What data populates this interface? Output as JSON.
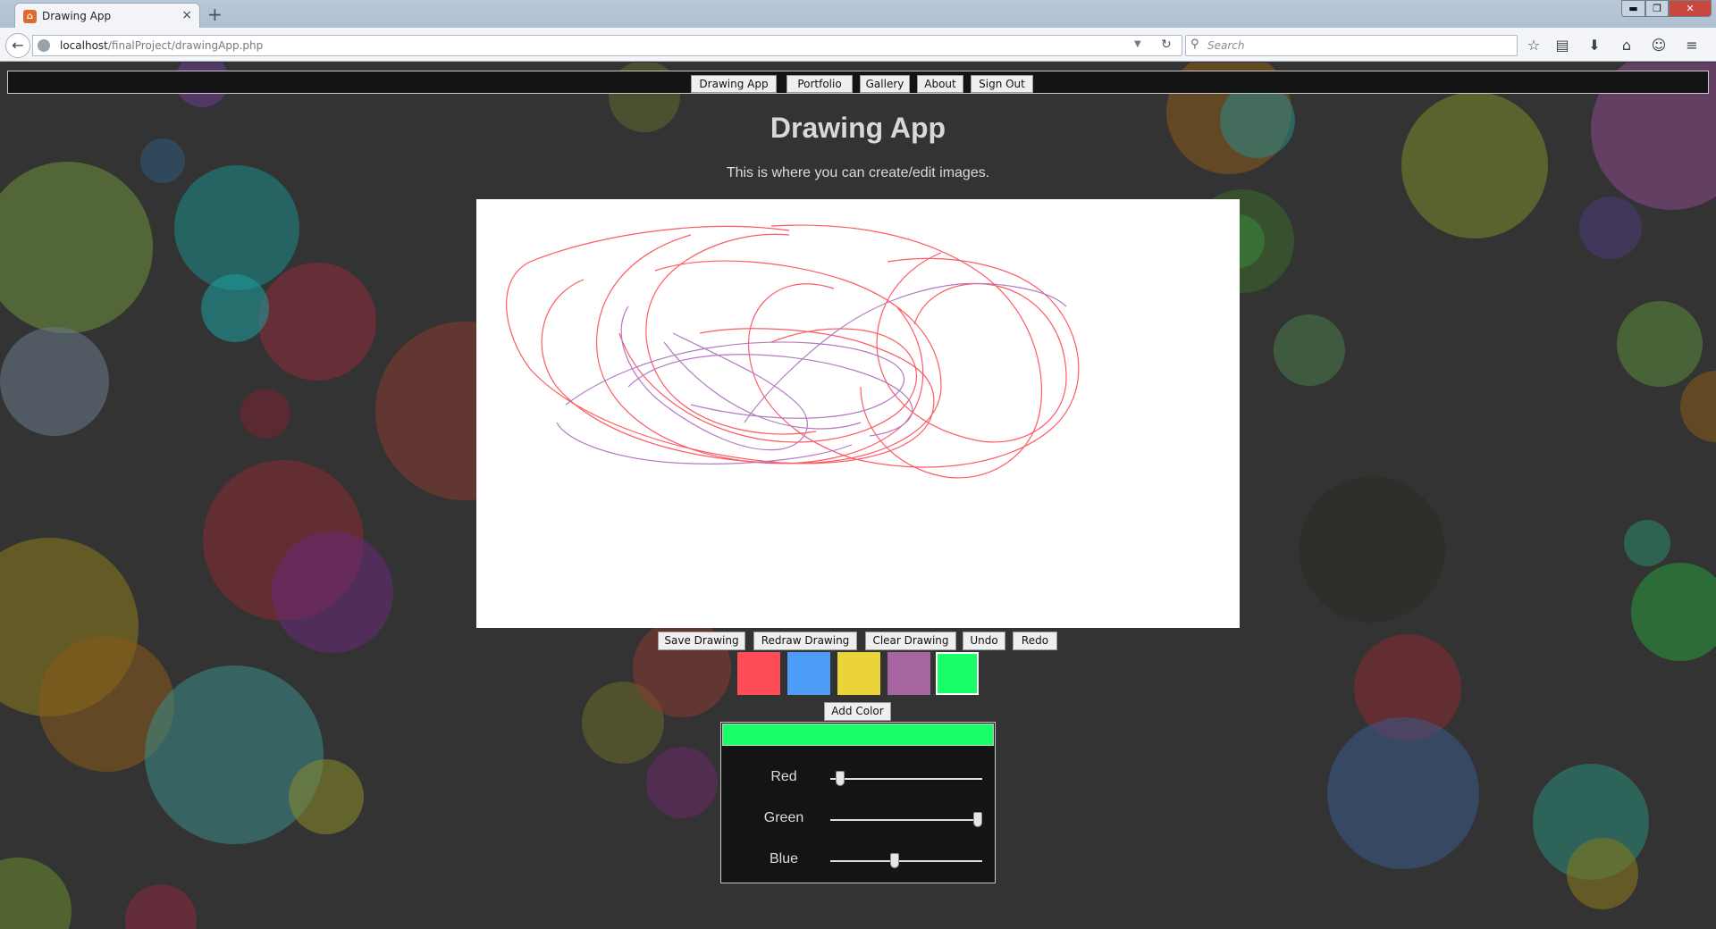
{
  "browser": {
    "tab_title": "Drawing App",
    "tab_close": "×",
    "new_tab": "+",
    "url_host": "localhost",
    "url_path": "/finalProject/drawingApp.php",
    "search_placeholder": "Search",
    "window_controls": {
      "minimize": "▬",
      "maximize": "❐",
      "close": "✕"
    },
    "toolbar_icons": [
      "star-icon",
      "reading-list-icon",
      "download-icon",
      "home-icon",
      "chat-icon",
      "menu-icon"
    ]
  },
  "site_nav": {
    "items": [
      {
        "label": "Drawing App"
      },
      {
        "label": "Portfolio"
      },
      {
        "label": "Gallery"
      },
      {
        "label": "About"
      },
      {
        "label": "Sign Out"
      }
    ]
  },
  "main": {
    "title": "Drawing App",
    "subtitle": "This is where you can create/edit images."
  },
  "actions": {
    "save": "Save Drawing",
    "redraw": "Redraw Drawing",
    "clear": "Clear Drawing",
    "undo": "Undo",
    "redo": "Redo"
  },
  "palette": {
    "swatches": [
      {
        "name": "red",
        "color": "#ff4d57"
      },
      {
        "name": "blue",
        "color": "#4d9cf8"
      },
      {
        "name": "yellow",
        "color": "#ead43a"
      },
      {
        "name": "purple",
        "color": "#a766a2"
      },
      {
        "name": "green",
        "color": "#19ff6a",
        "selected": true
      }
    ],
    "add_color_label": "Add Color"
  },
  "color_picker": {
    "preview_color": "#19ff6a",
    "sliders": [
      {
        "label": "Red",
        "value": 10,
        "max": 255
      },
      {
        "label": "Green",
        "value": 255,
        "max": 255
      },
      {
        "label": "Blue",
        "value": 106,
        "max": 255
      }
    ]
  },
  "canvas": {
    "background": "#ffffff",
    "stroke_colors": [
      "#ff5a64",
      "#b37ac0"
    ]
  }
}
